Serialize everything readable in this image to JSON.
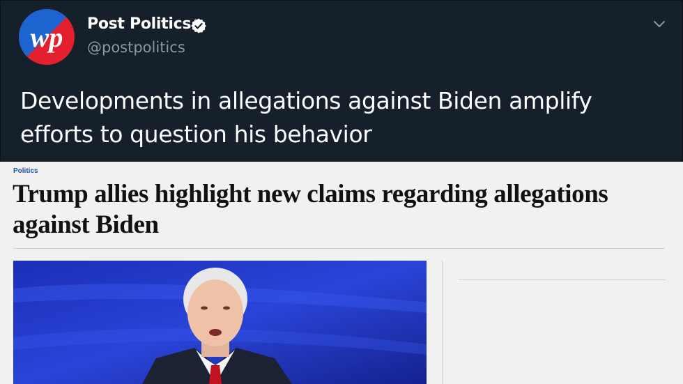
{
  "tweet": {
    "display_name": "Post Politics",
    "handle": "@postpolitics",
    "text": "Developments in allegations against Biden amplify efforts to question his behavior",
    "avatar_logo": "wp",
    "icons": {
      "verified": "verified-badge-icon",
      "menu": "chevron-down-icon"
    },
    "colors": {
      "background": "#15202b",
      "text": "#ffffff",
      "secondary": "#8899a6",
      "logo_red": "#e4202e",
      "logo_blue": "#1d64d0"
    }
  },
  "article": {
    "section_label": "Politics",
    "headline": "Trump allies highlight new claims regarding allegations against Biden",
    "image": "photo of a white-haired man in a dark suit and red tie speaking in front of a blue backdrop",
    "colors": {
      "section_label": "#1955a5",
      "headline": "#111111",
      "background": "#f1f1f1"
    }
  }
}
